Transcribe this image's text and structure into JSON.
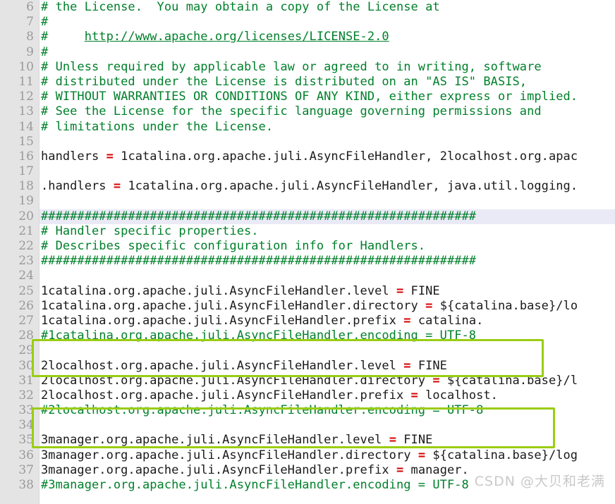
{
  "editor": {
    "file_type": "properties",
    "gutter_color": "#e4e4e4",
    "current_line_highlight_color": "#eaeaf7",
    "comment_color": "#00802b",
    "operator_color": "#d60000",
    "annotation_color": "#9acd12",
    "first_visible_line": 6,
    "last_visible_line": 38,
    "current_line": 20
  },
  "watermark": {
    "text": "CSDN @大贝和老满"
  },
  "annotations": [
    {
      "name": "highlight-box-catalina-encoding",
      "target_line": 28,
      "label": "#1catalina.org.apache.juli.AsyncFileHandler.encoding = UTF-8"
    },
    {
      "name": "highlight-box-localhost-encoding",
      "target_line": 33,
      "label": "#2localhost.org.apache.juli.AsyncFileHandler.encoding = UTF-8"
    }
  ],
  "lines": [
    {
      "n": "6",
      "text": "# the License.  You may obtain a copy of the License at",
      "kind": "comment",
      "hl": false
    },
    {
      "n": "7",
      "text": "#",
      "kind": "comment",
      "hl": false
    },
    {
      "n": "8",
      "text": "#     http://www.apache.org/licenses/LICENSE-2.0",
      "kind": "comment-link",
      "hl": false,
      "prefix": "#     ",
      "link": "http://www.apache.org/licenses/LICENSE-2.0"
    },
    {
      "n": "9",
      "text": "#",
      "kind": "comment",
      "hl": false
    },
    {
      "n": "10",
      "text": "# Unless required by applicable law or agreed to in writing, software",
      "kind": "comment",
      "hl": false
    },
    {
      "n": "11",
      "text": "# distributed under the License is distributed on an \"AS IS\" BASIS,",
      "kind": "comment",
      "hl": false
    },
    {
      "n": "12",
      "text": "# WITHOUT WARRANTIES OR CONDITIONS OF ANY KIND, either express or implied.",
      "kind": "comment",
      "hl": false
    },
    {
      "n": "13",
      "text": "# See the License for the specific language governing permissions and",
      "kind": "comment",
      "hl": false
    },
    {
      "n": "14",
      "text": "# limitations under the License.",
      "kind": "comment",
      "hl": false
    },
    {
      "n": "15",
      "text": "",
      "kind": "blank",
      "hl": false
    },
    {
      "n": "16",
      "text": "handlers = 1catalina.org.apache.juli.AsyncFileHandler, 2localhost.org.apac",
      "kind": "prop",
      "hl": false,
      "key": "handlers ",
      "op": "=",
      "value": " 1catalina.org.apache.juli.AsyncFileHandler, 2localhost.org.apac"
    },
    {
      "n": "17",
      "text": "",
      "kind": "blank",
      "hl": false
    },
    {
      "n": "18",
      "text": ".handlers = 1catalina.org.apache.juli.AsyncFileHandler, java.util.logging.",
      "kind": "prop",
      "hl": false,
      "key": ".handlers ",
      "op": "=",
      "value": " 1catalina.org.apache.juli.AsyncFileHandler, java.util.logging."
    },
    {
      "n": "19",
      "text": "",
      "kind": "blank",
      "hl": false
    },
    {
      "n": "20",
      "text": "############################################################",
      "kind": "comment",
      "hl": true
    },
    {
      "n": "21",
      "text": "# Handler specific properties.",
      "kind": "comment",
      "hl": false
    },
    {
      "n": "22",
      "text": "# Describes specific configuration info for Handlers.",
      "kind": "comment",
      "hl": false
    },
    {
      "n": "23",
      "text": "############################################################",
      "kind": "comment",
      "hl": false
    },
    {
      "n": "24",
      "text": "",
      "kind": "blank",
      "hl": false
    },
    {
      "n": "25",
      "text": "1catalina.org.apache.juli.AsyncFileHandler.level = FINE",
      "kind": "prop",
      "hl": false,
      "key": "1catalina.org.apache.juli.AsyncFileHandler.level ",
      "op": "=",
      "value": " FINE"
    },
    {
      "n": "26",
      "text": "1catalina.org.apache.juli.AsyncFileHandler.directory = ${catalina.base}/lo",
      "kind": "prop",
      "hl": false,
      "key": "1catalina.org.apache.juli.AsyncFileHandler.directory ",
      "op": "=",
      "value": " ${catalina.base}/lo"
    },
    {
      "n": "27",
      "text": "1catalina.org.apache.juli.AsyncFileHandler.prefix = catalina.",
      "kind": "prop",
      "hl": false,
      "key": "1catalina.org.apache.juli.AsyncFileHandler.prefix ",
      "op": "=",
      "value": " catalina."
    },
    {
      "n": "28",
      "text": "#1catalina.org.apache.juli.AsyncFileHandler.encoding = UTF-8",
      "kind": "comment",
      "hl": false
    },
    {
      "n": "29",
      "text": "",
      "kind": "blank",
      "hl": false
    },
    {
      "n": "30",
      "text": "2localhost.org.apache.juli.AsyncFileHandler.level = FINE",
      "kind": "prop",
      "hl": false,
      "key": "2localhost.org.apache.juli.AsyncFileHandler.level ",
      "op": "=",
      "value": " FINE"
    },
    {
      "n": "31",
      "text": "2localhost.org.apache.juli.AsyncFileHandler.directory = ${catalina.base}/l",
      "kind": "prop",
      "hl": false,
      "key": "2localhost.org.apache.juli.AsyncFileHandler.directory ",
      "op": "=",
      "value": " ${catalina.base}/l"
    },
    {
      "n": "32",
      "text": "2localhost.org.apache.juli.AsyncFileHandler.prefix = localhost.",
      "kind": "prop",
      "hl": false,
      "key": "2localhost.org.apache.juli.AsyncFileHandler.prefix ",
      "op": "=",
      "value": " localhost."
    },
    {
      "n": "33",
      "text": "#2localhost.org.apache.juli.AsyncFileHandler.encoding = UTF-8",
      "kind": "comment",
      "hl": false
    },
    {
      "n": "34",
      "text": "",
      "kind": "blank",
      "hl": false
    },
    {
      "n": "35",
      "text": "3manager.org.apache.juli.AsyncFileHandler.level = FINE",
      "kind": "prop",
      "hl": false,
      "key": "3manager.org.apache.juli.AsyncFileHandler.level ",
      "op": "=",
      "value": " FINE"
    },
    {
      "n": "36",
      "text": "3manager.org.apache.juli.AsyncFileHandler.directory = ${catalina.base}/log",
      "kind": "prop",
      "hl": false,
      "key": "3manager.org.apache.juli.AsyncFileHandler.directory ",
      "op": "=",
      "value": " ${catalina.base}/log"
    },
    {
      "n": "37",
      "text": "3manager.org.apache.juli.AsyncFileHandler.prefix = manager.",
      "kind": "prop",
      "hl": false,
      "key": "3manager.org.apache.juli.AsyncFileHandler.prefix ",
      "op": "=",
      "value": " manager."
    },
    {
      "n": "38",
      "text": "#3manager.org.apache.juli.AsyncFileHandler.encoding = UTF-8",
      "kind": "comment",
      "hl": false
    }
  ]
}
